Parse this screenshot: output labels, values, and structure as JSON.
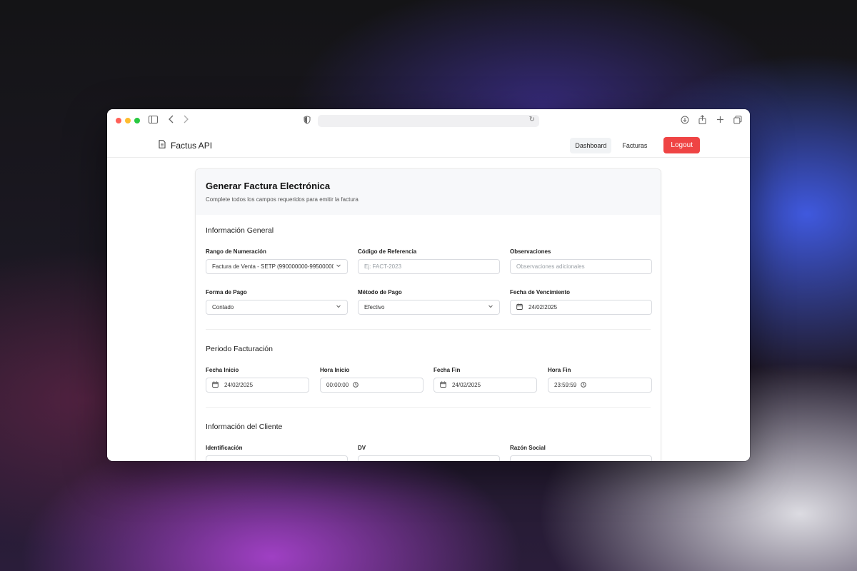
{
  "navbar": {
    "brand": "Factus API",
    "dashboard_label": "Dashboard",
    "facturas_label": "Facturas",
    "logout_label": "Logout"
  },
  "card": {
    "title": "Generar Factura Electrónica",
    "subtitle": "Complete todos los campos requeridos para emitir la factura"
  },
  "general": {
    "title": "Información General",
    "rango": {
      "label": "Rango de Numeración",
      "value": "Factura de Venta - SETP (990000000-995000000)"
    },
    "codigo": {
      "label": "Código de Referencia",
      "placeholder": "Ej: FACT-2023"
    },
    "observaciones": {
      "label": "Observaciones",
      "placeholder": "Observaciones adicionales"
    },
    "forma_pago": {
      "label": "Forma de Pago",
      "value": "Contado"
    },
    "metodo_pago": {
      "label": "Método de Pago",
      "value": "Efectivo"
    },
    "vencimiento": {
      "label": "Fecha de Vencimiento",
      "value": "24/02/2025"
    }
  },
  "periodo": {
    "title": "Periodo Facturación",
    "fecha_inicio": {
      "label": "Fecha Inicio",
      "value": "24/02/2025"
    },
    "hora_inicio": {
      "label": "Hora Inicio",
      "value": "00:00:00"
    },
    "fecha_fin": {
      "label": "Fecha Fin",
      "value": "24/02/2025"
    },
    "hora_fin": {
      "label": "Hora Fin",
      "value": "23:59:59"
    }
  },
  "cliente": {
    "title": "Información del Cliente",
    "identificacion": {
      "label": "Identificación"
    },
    "dv": {
      "label": "DV"
    },
    "razon_social": {
      "label": "Razón Social"
    }
  },
  "colors": {
    "accent_red": "#ef4444",
    "border": "#d9dbe0",
    "header_bg": "#f7f8fa"
  },
  "icons": [
    "sidebar-icon",
    "back-icon",
    "forward-icon",
    "shield-icon",
    "reload-icon",
    "download-icon",
    "share-icon",
    "plus-icon",
    "tabs-icon",
    "document-icon",
    "calendar-icon",
    "clock-icon",
    "chevron-down-icon"
  ]
}
